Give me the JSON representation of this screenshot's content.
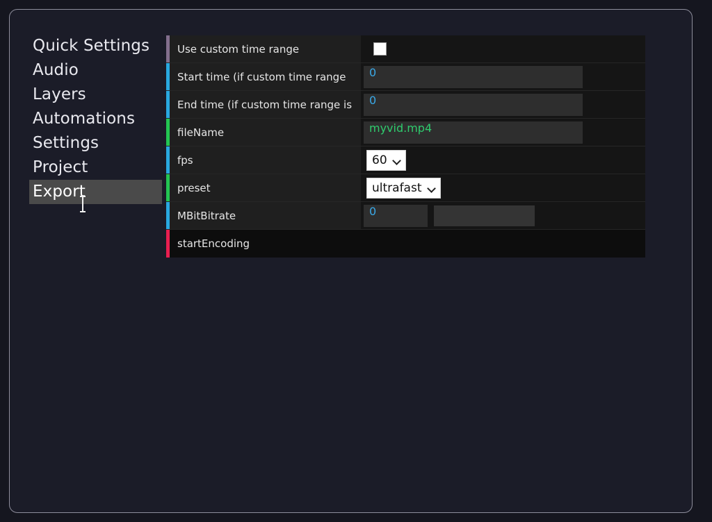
{
  "window": {
    "background": "#1b1c28",
    "border_color": "#8e8e9c"
  },
  "sidebar": {
    "items": [
      {
        "label": "Quick Settings",
        "active": false
      },
      {
        "label": "Audio",
        "active": false
      },
      {
        "label": "Layers",
        "active": false
      },
      {
        "label": "Automations",
        "active": false
      },
      {
        "label": "Settings",
        "active": false
      },
      {
        "label": "Project",
        "active": false
      },
      {
        "label": "Export",
        "active": true
      }
    ]
  },
  "panel": {
    "rows": [
      {
        "label": "Use custom time range",
        "accent": "#836f8d",
        "control": "checkbox",
        "checked": false
      },
      {
        "label": "Start time (if custom time range",
        "accent": "#29a8e0",
        "control": "text",
        "value": "0",
        "value_kind": "number"
      },
      {
        "label": "End time (if custom time range is",
        "accent": "#29a8e0",
        "control": "text",
        "value": "0",
        "value_kind": "number"
      },
      {
        "label": "fileName",
        "accent": "#23c552",
        "control": "text",
        "value": "myvid.mp4",
        "value_kind": "string"
      },
      {
        "label": "fps",
        "accent": "#29a8e0",
        "control": "select",
        "value": "60"
      },
      {
        "label": "preset",
        "accent": "#23c552",
        "control": "select",
        "value": "ultrafast"
      },
      {
        "label": "MBitBitrate",
        "accent": "#29a8e0",
        "control": "number-slider",
        "value": "0",
        "value_kind": "number"
      },
      {
        "label": "startEncoding",
        "accent": "#e91e50",
        "control": "action"
      }
    ]
  },
  "colors": {
    "accent_purple": "#836f8d",
    "accent_blue": "#29a8e0",
    "accent_green": "#23c552",
    "accent_pink": "#e91e50",
    "number_value": "#3aa9e8",
    "string_value": "#2fcb6d",
    "active_nav_bg": "#4a4a4a"
  }
}
